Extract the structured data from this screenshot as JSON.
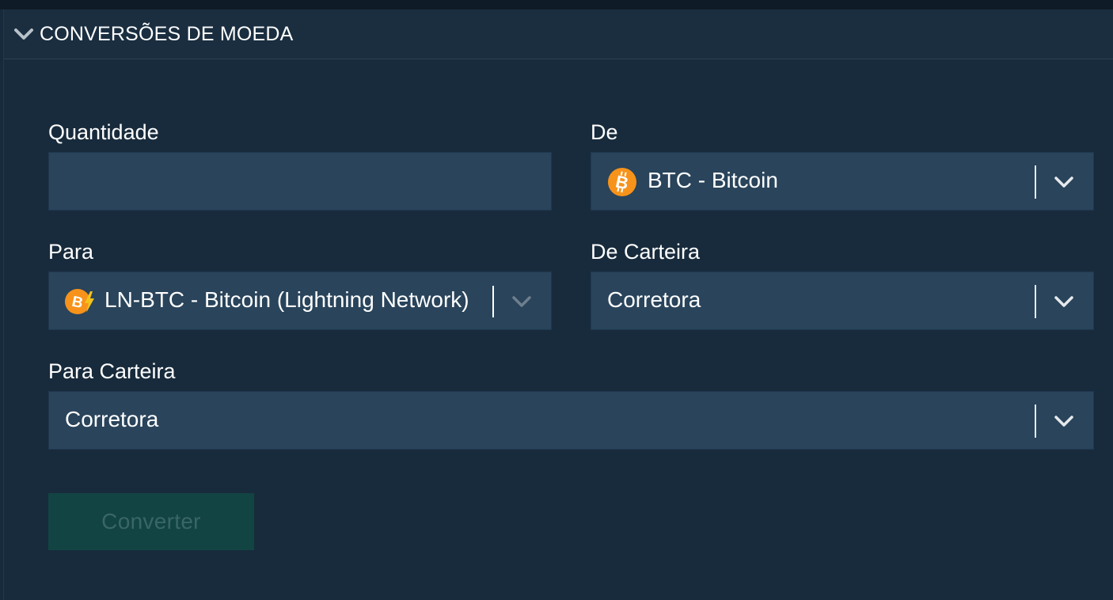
{
  "section": {
    "title": "CONVERSÕES DE MOEDA"
  },
  "form": {
    "quantity": {
      "label": "Quantidade",
      "value": ""
    },
    "from": {
      "label": "De",
      "selected": "BTC - Bitcoin",
      "icon": "bitcoin-icon"
    },
    "to": {
      "label": "Para",
      "selected": "LN-BTC - Bitcoin (Lightning Network)",
      "icon": "bitcoin-lightning-icon"
    },
    "from_wallet": {
      "label": "De Carteira",
      "selected": "Corretora"
    },
    "to_wallet": {
      "label": "Para Carteira",
      "selected": "Corretora"
    },
    "submit_label": "Converter"
  },
  "colors": {
    "background": "#182b3c",
    "field": "#29445b",
    "bitcoin": "#f7931a",
    "lightning": "#f4c21b",
    "button_disabled": "#124443"
  }
}
